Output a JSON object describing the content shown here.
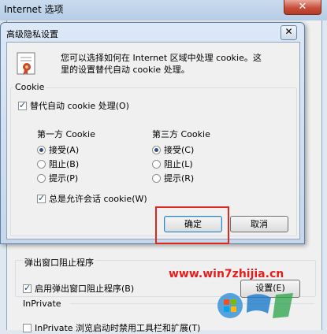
{
  "parent": {
    "title": "Internet 选项",
    "close_glyph": "✕",
    "popup_group_label": "弹出窗口阻止程序",
    "popup_checkbox_label": "启用弹出窗口阻止程序(B)",
    "popup_checkbox_checked": true,
    "settings_button": "设置(E)",
    "inprivate_label": "InPrivate",
    "inprivate_checkbox_label": "InPrivate 浏览启动时禁用工具栏和扩展(T)",
    "inprivate_checkbox_checked": false,
    "watermark": "www.win7zhijia.cn"
  },
  "dialog": {
    "title": "高级隐私设置",
    "close_glyph": "✕",
    "icon": "privacy-certificate-icon",
    "description_line1": "您可以选择如何在 Internet 区域中处理 cookie。这",
    "description_line2": "里的设置替代自动 cookie 处理。",
    "cookie_group_label": "Cookie",
    "override_label": "替代自动 cookie 处理(O)",
    "override_checked": true,
    "first_party": {
      "heading": "第一方 Cookie",
      "options": [
        "接受(A)",
        "阻止(B)",
        "提示(P)"
      ],
      "selected": 0
    },
    "third_party": {
      "heading": "第三方 Cookie",
      "options": [
        "接受(C)",
        "阻止(L)",
        "提示(R)"
      ],
      "selected": 0
    },
    "session_label": "总是允许会话 cookie(W)",
    "session_checked": true,
    "ok_button": "确定",
    "cancel_button": "取消",
    "highlight_color": "#e0271b"
  }
}
